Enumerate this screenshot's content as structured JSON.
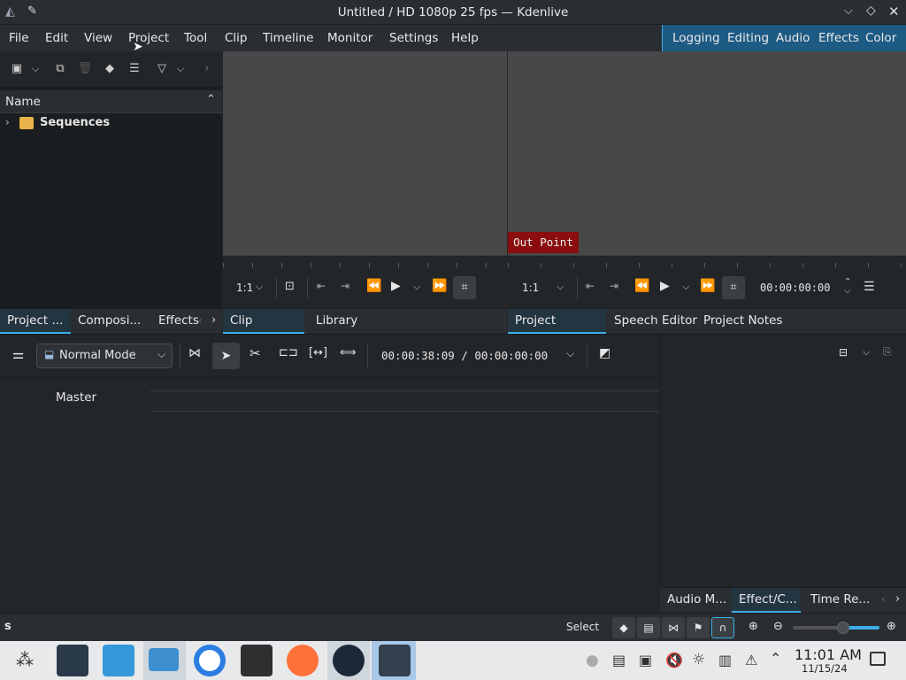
{
  "window": {
    "title": "Untitled / HD 1080p 25 fps — Kdenlive"
  },
  "menu": [
    "File",
    "Edit",
    "View",
    "Project",
    "Tool",
    "Clip",
    "Timeline",
    "Monitor",
    "Settings",
    "Help"
  ],
  "layouts": [
    "Logging",
    "Editing",
    "Audio",
    "Effects",
    "Color"
  ],
  "bin": {
    "column_name": "Name",
    "items": [
      {
        "label": "Sequences"
      }
    ]
  },
  "left_tabs": [
    "Project ...",
    "Composi...",
    "Effects"
  ],
  "clip_monitor": {
    "zoom": "1:1",
    "tabs": [
      "Clip Monitor",
      "Library"
    ]
  },
  "project_monitor": {
    "zoom": "1:1",
    "out_point_label": "Out Point",
    "timecode": "00:00:00:00",
    "tabs": [
      "Project Monitor",
      "Speech Editor",
      "Project Notes"
    ]
  },
  "timeline": {
    "mode": "Normal Mode",
    "timecode": "00:00:38:09 / 00:00:00:00",
    "master_label": "Master"
  },
  "right_tabs": [
    "Audio M...",
    "Effect/C...",
    "Time Re..."
  ],
  "status": {
    "left_text": "s",
    "tool_text": "Select"
  },
  "clock": {
    "time": "11:01 AM",
    "date": "11/15/24"
  },
  "colors": {
    "accent": "#3daee9",
    "out_point_bg": "#8b0d0d",
    "monitor_bg": "#484848"
  }
}
